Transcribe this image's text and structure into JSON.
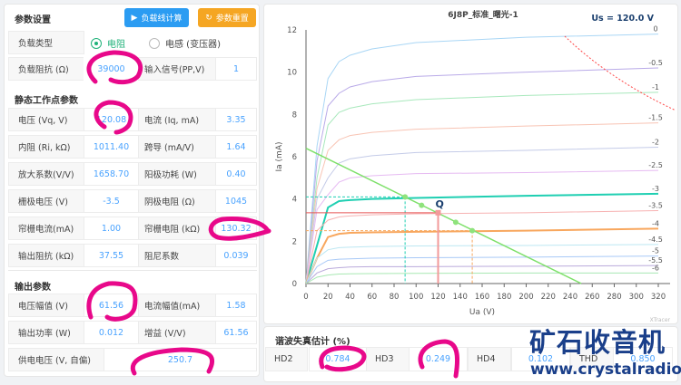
{
  "settings": {
    "title": "参数设置",
    "btn_calc": "负载线计算",
    "btn_reset": "参数重置",
    "load_type_label": "负载类型",
    "load_type_options": [
      "电阻",
      "电感 (变压器)"
    ],
    "load_type_selected": "电阻",
    "load_imp_label": "负载阻抗 (Ω)",
    "load_imp_value": "39000",
    "input_label": "输入信号(PP,V)",
    "input_value": "1"
  },
  "static": {
    "title": "静态工作点参数",
    "rows": [
      {
        "l1": "电压 (Vq, V)",
        "v1": "120.08",
        "l2": "电流 (Iq, mA)",
        "v2": "3.35"
      },
      {
        "l1": "内阻 (Ri, kΩ)",
        "v1": "1011.40",
        "l2": "跨导 (mA/V)",
        "v2": "1.64"
      },
      {
        "l1": "放大系数(V/V)",
        "v1": "1658.70",
        "l2": "阳极功耗 (W)",
        "v2": "0.40"
      },
      {
        "l1": "栅极电压 (V)",
        "v1": "-3.5",
        "l2": "阴极电阻 (Ω)",
        "v2": "1045"
      },
      {
        "l1": "帘栅电流(mA)",
        "v1": "1.00",
        "l2": "帘栅电阻 (kΩ)",
        "v2": "130.32"
      },
      {
        "l1": "输出阻抗 (kΩ)",
        "v1": "37.55",
        "l2": "阻尼系数",
        "v2": "0.039"
      }
    ]
  },
  "output": {
    "title": "输出参数",
    "rows": [
      {
        "l1": "电压幅值 (V)",
        "v1": "61.56",
        "l2": "电流幅值(mA)",
        "v2": "1.58"
      },
      {
        "l1": "输出功率 (W)",
        "v1": "0.012",
        "l2": "增益 (V/V)",
        "v2": "61.56"
      }
    ],
    "supply_label": "供电电压 (V, 自偏)",
    "supply_value": "250.7"
  },
  "harmonics": {
    "title": "谐波失真估计 (%)",
    "items": [
      {
        "label": "HD2",
        "value": "0.784"
      },
      {
        "label": "HD3",
        "value": "0.249"
      },
      {
        "label": "HD4",
        "value": "0.102"
      },
      {
        "label": "THD",
        "value": "0.850"
      }
    ]
  },
  "watermark": {
    "cn": "矿石收音机",
    "url": "www.crystalradio.cn"
  },
  "colors": {
    "accent": "#4aa3ff",
    "calc_button": "#2b9cf2",
    "reset_button": "#f5a623",
    "annotation": "#e8088a",
    "load_line": "#7ee06a"
  },
  "chart_data": {
    "type": "line",
    "title": "6J8P_标准_曙光-1",
    "annotation": "Us = 120.0 V",
    "xlabel": "Ua (V)",
    "ylabel": "Ia (mA)",
    "xlim": [
      0,
      320
    ],
    "ylim": [
      0,
      12
    ],
    "xticks": [
      0,
      20,
      40,
      60,
      80,
      100,
      120,
      140,
      160,
      180,
      200,
      220,
      240,
      260,
      280,
      300,
      320
    ],
    "yticks": [
      0,
      2,
      4,
      6,
      8,
      10,
      12
    ],
    "credit": "XTracer",
    "x": [
      0,
      10,
      20,
      30,
      40,
      60,
      100,
      200,
      320
    ],
    "series": [
      {
        "name": "0",
        "color": "#a9d6f5",
        "values": [
          0,
          6.5,
          9.7,
          10.5,
          10.8,
          11.1,
          11.4,
          11.65,
          11.8
        ]
      },
      {
        "name": "-0.5",
        "color": "#b9aae8",
        "values": [
          0,
          5.8,
          8.4,
          9.0,
          9.3,
          9.55,
          9.8,
          10.0,
          10.2
        ]
      },
      {
        "name": "-1",
        "color": "#a8e8bc",
        "values": [
          0,
          5.0,
          7.5,
          8.1,
          8.3,
          8.5,
          8.7,
          8.9,
          9.05
        ]
      },
      {
        "name": "-1.5",
        "color": "#f8c4b4",
        "values": [
          0,
          4.5,
          6.3,
          6.8,
          7.0,
          7.15,
          7.3,
          7.45,
          7.6
        ]
      },
      {
        "name": "-2",
        "color": "#c4cbe8",
        "values": [
          0,
          4.0,
          5.0,
          5.7,
          5.9,
          6.05,
          6.2,
          6.3,
          6.45
        ]
      },
      {
        "name": "-2.5",
        "color": "#e6baf2",
        "values": [
          0,
          3.5,
          4.2,
          4.8,
          5.0,
          5.1,
          5.2,
          5.25,
          5.35
        ]
      },
      {
        "name": "-3",
        "color": "#1fcfb2",
        "bold": true,
        "values": [
          0,
          1.8,
          3.6,
          3.9,
          3.95,
          4.0,
          4.05,
          4.15,
          4.25
        ]
      },
      {
        "name": "-3.5",
        "color": "#f7b2b2",
        "values": [
          0,
          2.5,
          3.0,
          3.15,
          3.2,
          3.25,
          3.3,
          3.35,
          3.45
        ]
      },
      {
        "name": "-4",
        "color": "#f8a75e",
        "bold": true,
        "values": [
          0,
          1.2,
          2.2,
          2.35,
          2.4,
          2.42,
          2.45,
          2.5,
          2.6
        ]
      },
      {
        "name": "-4.5",
        "color": "#bce7f2",
        "values": [
          0,
          1.2,
          1.6,
          1.7,
          1.72,
          1.75,
          1.78,
          1.8,
          1.85
        ]
      },
      {
        "name": "-5",
        "color": "#a8c9f7",
        "values": [
          0,
          0.8,
          1.1,
          1.15,
          1.17,
          1.2,
          1.22,
          1.25,
          1.3
        ]
      },
      {
        "name": "-5.5",
        "color": "#baaadb",
        "values": [
          0,
          0.5,
          0.7,
          0.75,
          0.78,
          0.8,
          0.8,
          0.82,
          0.85
        ]
      },
      {
        "name": "-6",
        "color": "#a8e8b2",
        "values": [
          0,
          0.3,
          0.4,
          0.45,
          0.46,
          0.47,
          0.48,
          0.5,
          0.5
        ]
      }
    ],
    "load_line": {
      "from": [
        0,
        6.4
      ],
      "to": [
        250,
        0
      ]
    },
    "q_point": {
      "label": "Q",
      "x": 120,
      "y": 3.35
    },
    "swing_points": [
      [
        90,
        4.1
      ],
      [
        105,
        3.7
      ],
      [
        136,
        2.9
      ],
      [
        151,
        2.5
      ]
    ],
    "max_dissipation_w": 2.75
  }
}
